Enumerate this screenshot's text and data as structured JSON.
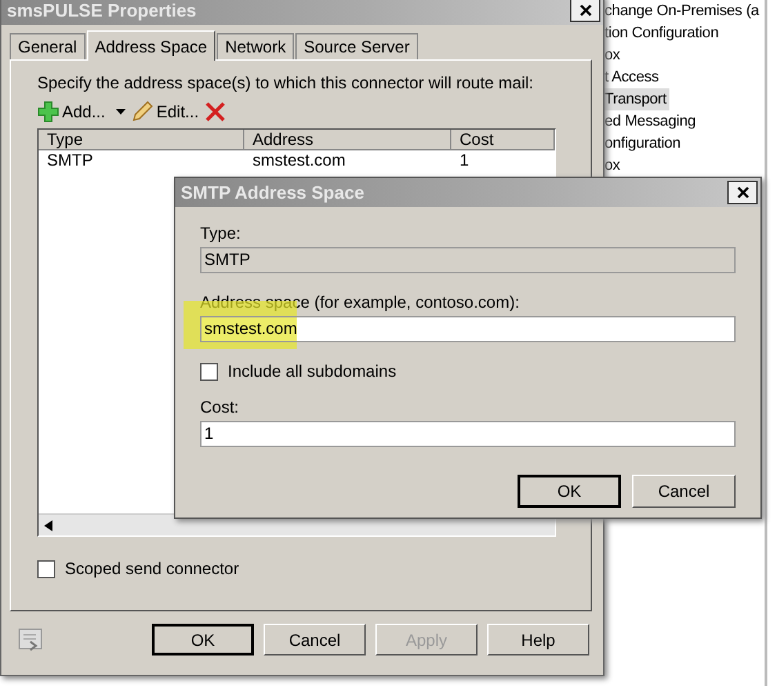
{
  "background_list": {
    "items": [
      {
        "label": "change On-Premises (a",
        "selected": false
      },
      {
        "label": "tion Configuration",
        "selected": false
      },
      {
        "label": "ox",
        "selected": false
      },
      {
        "label": "t Access",
        "selected": false
      },
      {
        "label": "Transport",
        "selected": true
      },
      {
        "label": "ed Messaging",
        "selected": false
      },
      {
        "label": "onfiguration",
        "selected": false
      },
      {
        "label": "ox",
        "selected": false
      }
    ]
  },
  "main_window": {
    "title": "smsPULSE Properties",
    "tabs": [
      {
        "label": "General",
        "selected": false
      },
      {
        "label": "Address Space",
        "selected": true
      },
      {
        "label": "Network",
        "selected": false
      },
      {
        "label": "Source Server",
        "selected": false
      }
    ],
    "instruction": "Specify the address space(s) to which this connector will route mail:",
    "toolbar": [
      {
        "kind": "add",
        "label": "Add..."
      },
      {
        "kind": "dropdown"
      },
      {
        "kind": "edit",
        "label": "Edit..."
      },
      {
        "kind": "delete"
      }
    ],
    "table": {
      "columns": [
        "Type",
        "Address",
        "Cost"
      ],
      "rows": [
        [
          "SMTP",
          "smstest.com",
          "1"
        ]
      ]
    },
    "scoped_send_connector": {
      "label": "Scoped send connector",
      "checked": false
    },
    "buttons": [
      {
        "label": "OK",
        "default": true,
        "disabled": false
      },
      {
        "label": "Cancel",
        "default": false,
        "disabled": false
      },
      {
        "label": "Apply",
        "default": false,
        "disabled": true
      },
      {
        "label": "Help",
        "default": false,
        "disabled": false
      }
    ]
  },
  "dialog": {
    "title": "SMTP Address Space",
    "type_label": "Type:",
    "type_value": "SMTP",
    "address_label": "Address space (for example, contoso.com):",
    "address_value": "smstest.com",
    "include_subdomains": {
      "label": "Include all subdomains",
      "checked": false
    },
    "cost_label": "Cost:",
    "cost_value": "1",
    "buttons": [
      {
        "label": "OK",
        "default": true
      },
      {
        "label": "Cancel",
        "default": false
      }
    ]
  }
}
